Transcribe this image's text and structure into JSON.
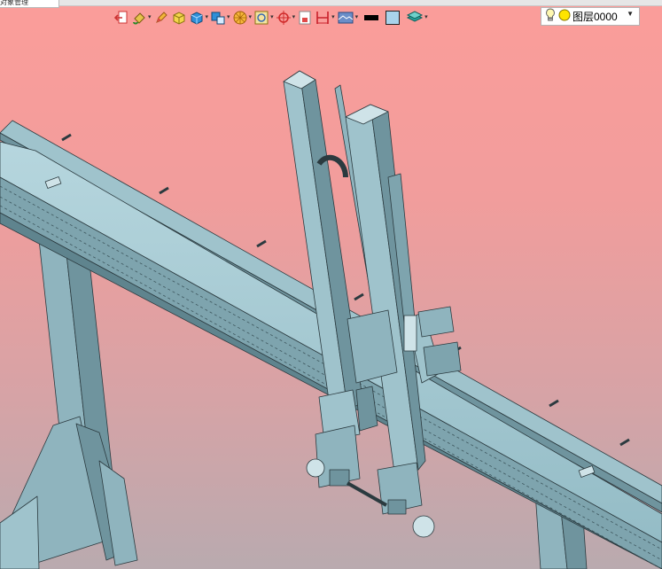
{
  "window": {
    "tab_stub": "对象管理"
  },
  "toolbar": {
    "tools": [
      {
        "icon": "exit-sketch-icon",
        "caret": false
      },
      {
        "icon": "paint-bucket-icon",
        "caret": true
      },
      {
        "icon": "pencil-icon",
        "caret": false
      },
      {
        "icon": "shaded-box-icon",
        "caret": false
      },
      {
        "icon": "blue-cube-icon",
        "caret": true
      },
      {
        "icon": "view-orientation-icon",
        "caret": true
      },
      {
        "icon": "render-style-icon",
        "caret": true
      },
      {
        "icon": "zoom-fit-icon",
        "caret": true
      },
      {
        "icon": "crosshair-icon",
        "caret": true
      },
      {
        "icon": "section-view-icon",
        "caret": false
      },
      {
        "icon": "dimension-icon",
        "caret": true
      },
      {
        "icon": "texture-icon",
        "caret": true
      },
      {
        "icon": "line-color-icon",
        "caret": false
      },
      {
        "icon": "fill-color-icon",
        "caret": false
      },
      {
        "icon": "layers-icon",
        "caret": true
      }
    ],
    "colors": {
      "line": "#000000",
      "fill": "#a9d3eb"
    }
  },
  "layer": {
    "name": "图层0000",
    "bulb_color": "#f5e642",
    "status_color": "#ffe400"
  },
  "viewport": {
    "model": "gantry-robot-3d-model",
    "colors": {
      "part": "#9fc3cc",
      "part_dark": "#6f949e",
      "edge": "#2b3a3f",
      "bg_top": "#fb9d9a",
      "bg_bottom": "#b9aaaf"
    }
  }
}
